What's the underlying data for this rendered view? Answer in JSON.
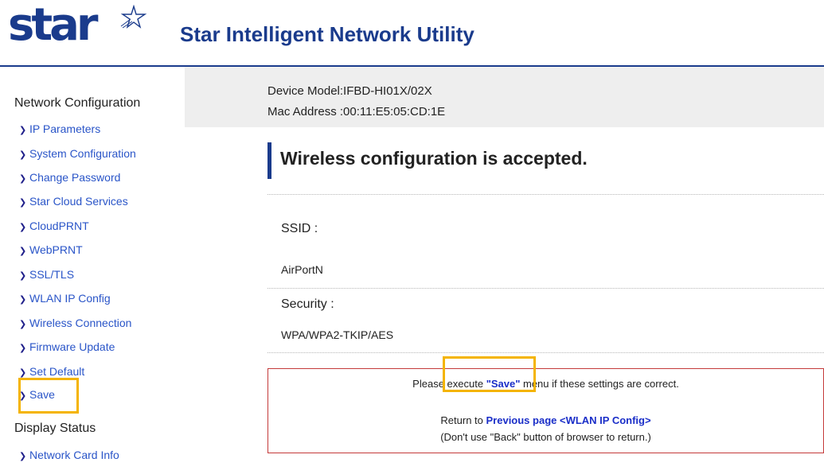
{
  "header": {
    "logo_text": "star",
    "title": "Star Intelligent Network Utility"
  },
  "sidebar": {
    "network_section": "Network Configuration",
    "network_items": [
      {
        "label": "IP Parameters"
      },
      {
        "label": "System Configuration"
      },
      {
        "label": "Change Password"
      },
      {
        "label": "Star Cloud Services"
      },
      {
        "label": "CloudPRNT"
      },
      {
        "label": "WebPRNT"
      },
      {
        "label": "SSL/TLS"
      },
      {
        "label": "WLAN IP Config"
      },
      {
        "label": "Wireless Connection"
      },
      {
        "label": "Firmware Update"
      },
      {
        "label": "Set Default"
      },
      {
        "label": "Save"
      }
    ],
    "display_section": "Display Status",
    "display_items": [
      {
        "label": "Network Card Info"
      }
    ]
  },
  "device": {
    "model_line": "Device Model:IFBD-HI01X/02X",
    "mac_line": "Mac Address :00:11:E5:05:CD:1E"
  },
  "main": {
    "title": "Wireless configuration is accepted.",
    "ssid_label": "SSID :",
    "ssid_value": "AirPortN",
    "security_label": "Security :",
    "security_value": "WPA/WPA2-TKIP/AES"
  },
  "notice": {
    "line1_pre": "Please execute ",
    "line1_link": "\"Save\"",
    "line1_post": " menu if these settings are correct.",
    "line2_pre": "Return to ",
    "line2_link": "Previous page <WLAN IP Config>",
    "line3": "(Don't use \"Back\" button of browser to return.)"
  },
  "colors": {
    "brand": "#1a3b8c",
    "link": "#2a55c8",
    "notice_border": "#c43a3a",
    "highlight": "#f4b400"
  }
}
